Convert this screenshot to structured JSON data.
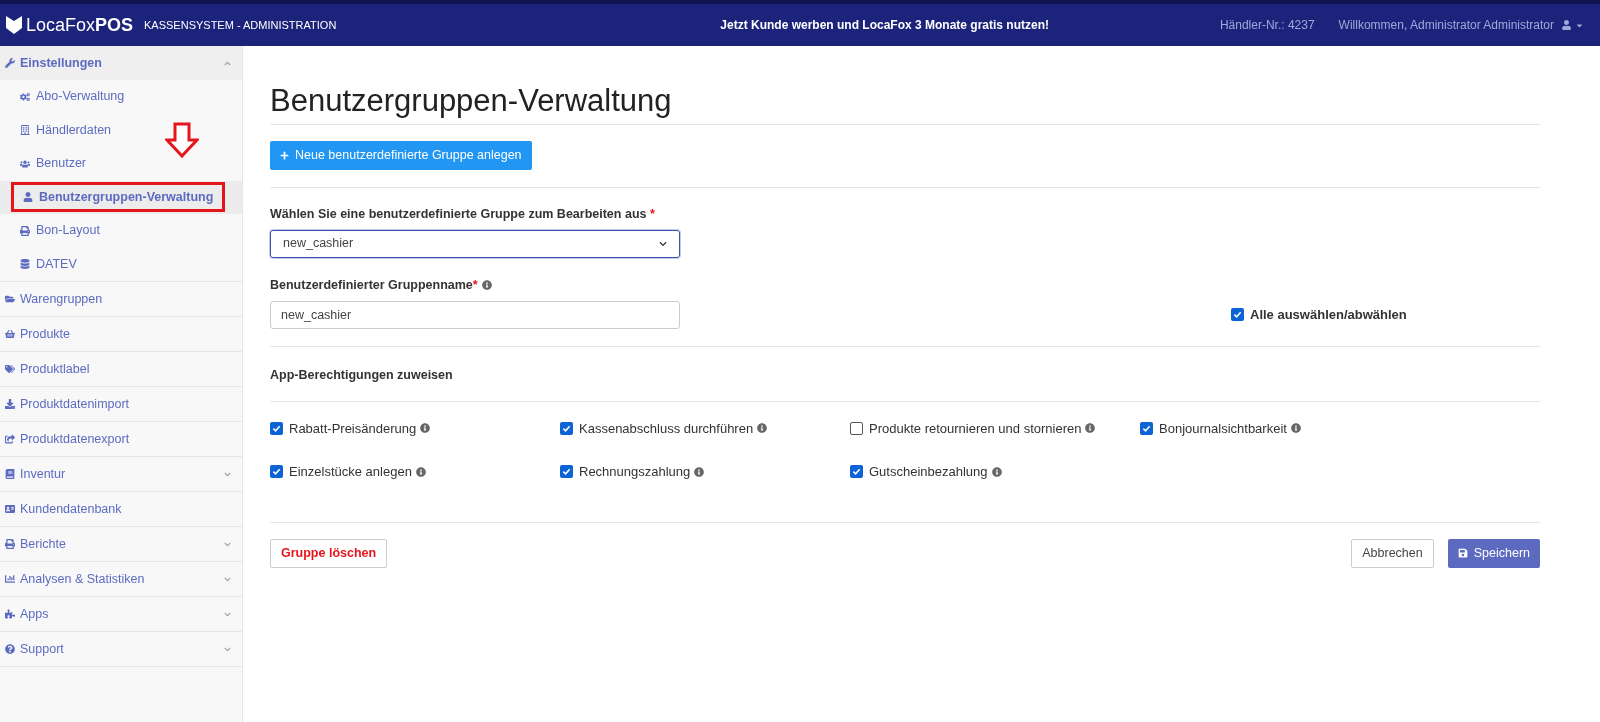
{
  "header": {
    "logo": "LocaFox",
    "logo_bold": "POS",
    "subtitle": "KASSENSYSTEM - ADMINISTRATION",
    "promo": "Jetzt Kunde werben und LocaFox 3 Monate gratis nutzen!",
    "merchant_number": "Händler-Nr.: 4237",
    "welcome": "Willkommen, Administrator Administrator"
  },
  "sidebar": {
    "items": [
      {
        "label": "Einstellungen",
        "expandable": true,
        "expanded": true,
        "children": [
          {
            "label": "Abo-Verwaltung",
            "selected": false
          },
          {
            "label": "Händlerdaten",
            "selected": false
          },
          {
            "label": "Benutzer",
            "selected": false
          },
          {
            "label": "Benutzergruppen-Verwaltung",
            "selected": true
          },
          {
            "label": "Bon-Layout",
            "selected": false
          },
          {
            "label": "DATEV",
            "selected": false
          }
        ]
      },
      {
        "label": "Warengruppen",
        "expandable": false,
        "expanded": false
      },
      {
        "label": "Produkte",
        "expandable": false,
        "expanded": false
      },
      {
        "label": "Produktlabel",
        "expandable": false,
        "expanded": false
      },
      {
        "label": "Produktdatenimport",
        "expandable": false,
        "expanded": false
      },
      {
        "label": "Produktdatenexport",
        "expandable": false,
        "expanded": false
      },
      {
        "label": "Inventur",
        "expandable": true,
        "expanded": false
      },
      {
        "label": "Kundendatenbank",
        "expandable": false,
        "expanded": false
      },
      {
        "label": "Berichte",
        "expandable": true,
        "expanded": false
      },
      {
        "label": "Analysen & Statistiken",
        "expandable": true,
        "expanded": false
      },
      {
        "label": "Apps",
        "expandable": true,
        "expanded": false
      },
      {
        "label": "Support",
        "expandable": true,
        "expanded": false
      }
    ]
  },
  "page": {
    "title": "Benutzergruppen-Verwaltung",
    "new_group_button": "Neue benutzerdefinierte Gruppe anlegen",
    "group_select": {
      "label": "Wählen Sie eine benutzerdefinierte Gruppe zum Bearbeiten aus",
      "required_mark": "*",
      "value": "new_cashier"
    },
    "group_name": {
      "label": "Benutzerdefinierter Gruppenname",
      "required_mark": "*",
      "value": "new_cashier"
    },
    "select_all": {
      "label": "Alle auswählen/abwählen",
      "checked": true
    },
    "permissions_heading": "App-Berechtigungen zuweisen",
    "permissions": [
      {
        "label": "Rabatt-Preisänderung",
        "checked": true
      },
      {
        "label": "Kassenabschluss durchführen",
        "checked": true
      },
      {
        "label": "Produkte retournieren und stornieren",
        "checked": false
      },
      {
        "label": "Bonjournalsichtbarkeit",
        "checked": true
      },
      {
        "label": "Einzelstücke anlegen",
        "checked": true
      },
      {
        "label": "Rechnungszahlung",
        "checked": true
      },
      {
        "label": "Gutscheinbezahlung",
        "checked": true
      }
    ],
    "delete_button": "Gruppe löschen",
    "cancel_button": "Abbrechen",
    "save_button": "Speichern"
  }
}
